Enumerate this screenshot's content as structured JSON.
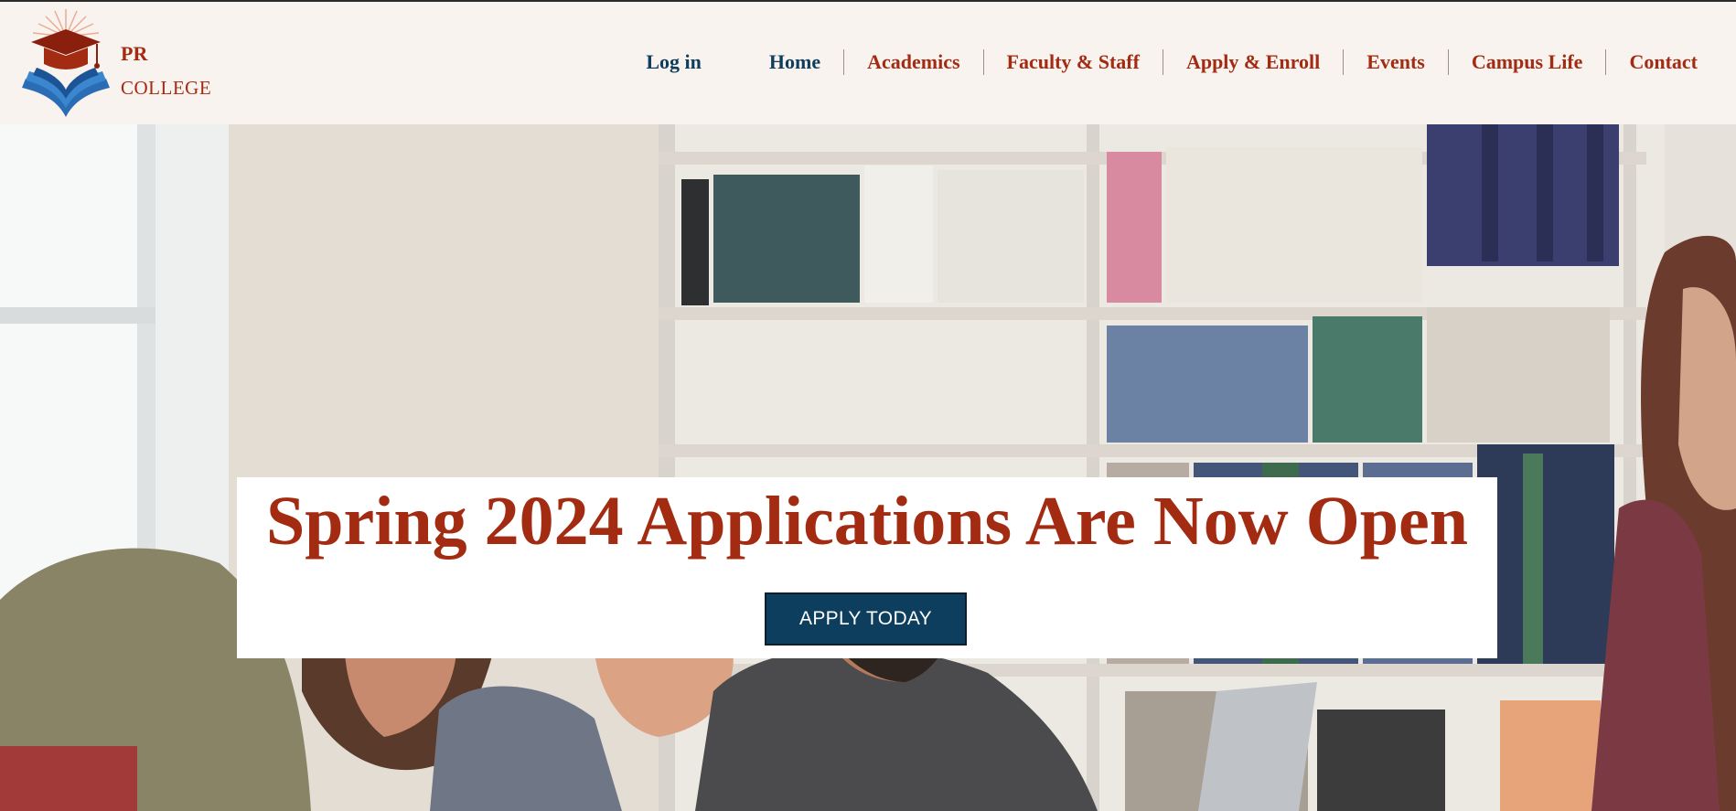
{
  "brand": {
    "name_line1": "PR",
    "name_line2": "COLLEGE",
    "logo_icon": "graduation-cap-book-icon",
    "color_red": "#a32b12",
    "color_navy": "#0f3d5c"
  },
  "nav": {
    "login": "Log in",
    "home": "Home",
    "academics": "Academics",
    "faculty": "Faculty & Staff",
    "apply": "Apply & Enroll",
    "events": "Events",
    "campus_life": "Campus Life",
    "contact": "Contact"
  },
  "hero": {
    "headline": "Spring 2024 Applications Are Now Open",
    "cta_label": "APPLY TODAY",
    "background": "photo of laughing students in a library with bookshelves"
  }
}
